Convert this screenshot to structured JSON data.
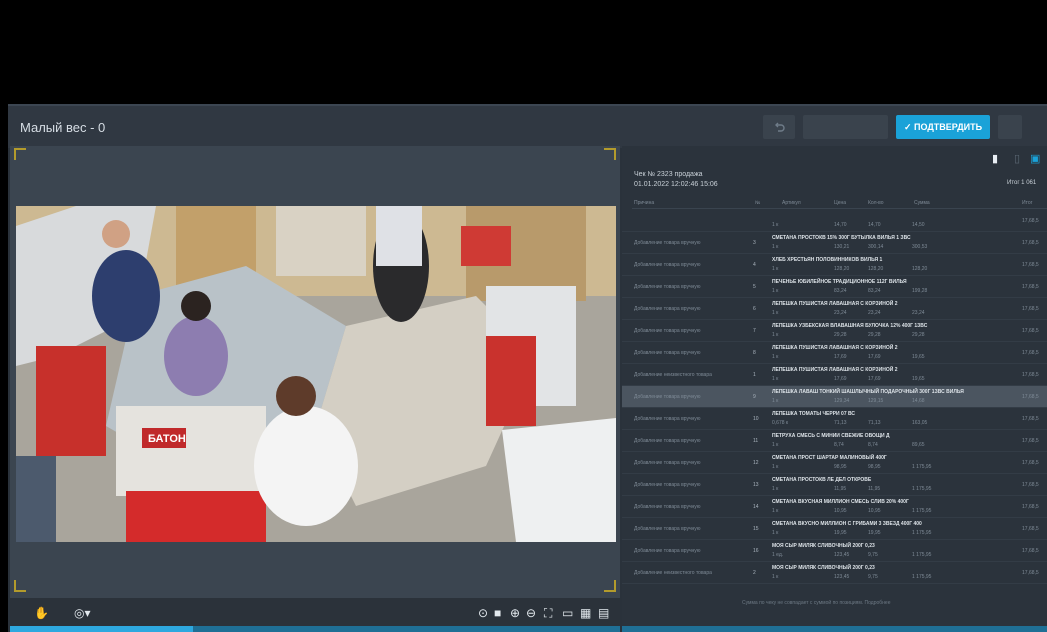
{
  "header": {
    "title": "Малый вес - 0",
    "confirm_label": "✓ ПОДТВЕРДИТЬ"
  },
  "video": {
    "bag_text": "БАТОН",
    "progress_percent": 30
  },
  "receipt": {
    "title": "Чек № 2323 продажа",
    "datetime": "01.01.2022 12:02:46 15:06",
    "total_label": "Итог 1 061",
    "columns": [
      "Причина",
      "№",
      "Артикул",
      "Цена",
      "Кол-во",
      "Сумма",
      "Итог"
    ],
    "rows": [
      {
        "cat": "",
        "num": "",
        "name": "",
        "sub": "1 к",
        "price": "14,70",
        "qty": "14,70",
        "sum": "14,50",
        "total": "17,68,5"
      },
      {
        "cat": "Добавление товара вручную",
        "num": "3",
        "name": "СМЕТАНА ПРОСТОКВ 15% 300Г БУТЫЛКА ВИЛЬЯ 1 ЗВС",
        "sub": "1 к",
        "price": "130,21",
        "qty": "300,14",
        "sum": "300,53",
        "total": "17,68,5"
      },
      {
        "cat": "Добавление товара вручную",
        "num": "4",
        "name": "ХЛЕБ ХРЕСТЬЯН ПОЛОВИННИКОВ ВИЛЬЯ 1",
        "sub": "1 к",
        "price": "128,20",
        "qty": "128,20",
        "sum": "128,20",
        "total": "17,68,5"
      },
      {
        "cat": "Добавление товара вручную",
        "num": "5",
        "name": "ПЕЧЕНЬЕ ЮБИЛЕЙНОЕ ТРАДИЦИОННОЕ 112Г ВИЛЬЯ",
        "sub": "1 к",
        "price": "83,24",
        "qty": "83,24",
        "sum": "199,28",
        "total": "17,68,5"
      },
      {
        "cat": "Добавление товара вручную",
        "num": "6",
        "name": "ЛЕПЕШКА ПУШИСТАЯ ЛАВАШНАЯ С КОРЗИНОЙ 2",
        "sub": "1 к",
        "price": "23,24",
        "qty": "23,24",
        "sum": "23,24",
        "total": "17,68,5"
      },
      {
        "cat": "Добавление товара вручную",
        "num": "7",
        "name": "ЛЕПЕШКА УЗБЕКСКАЯ ВЛАВАШНАЯ БУЛОЧКА 12% 400Г 1ЗВС",
        "sub": "1 к",
        "price": "29,28",
        "qty": "29,28",
        "sum": "29,28",
        "total": "17,68,5"
      },
      {
        "cat": "Добавление товара вручную",
        "num": "8",
        "name": "ЛЕПЕШКА ПУШИСТАЯ ЛАВАШНАЯ С КОРЗИНОЙ 2",
        "sub": "1 к",
        "price": "17,69",
        "qty": "17,69",
        "sum": "19,65",
        "total": "17,68,5"
      },
      {
        "cat": "Добавление неизвестного товара",
        "num": "1",
        "name": "ЛЕПЕШКА ПУШИСТАЯ ЛАВАШНАЯ С КОРЗИНОЙ 2",
        "sub": "1 к",
        "price": "17,69",
        "qty": "17,69",
        "sum": "19,65",
        "total": "17,68,5"
      },
      {
        "cat": "Добавление товара вручную",
        "num": "9",
        "name": "ЛЕПЕШКА ЛАВАШ ТОНКИЙ ШАШЛЫЧНЫЙ ПОДАРОЧНЫЙ 300Г 1ЗВС ВИЛЬЯ",
        "sub": "1 к",
        "price": "129,34",
        "qty": "129,15",
        "sum": "14,68",
        "total": "17,68,5",
        "selected": true
      },
      {
        "cat": "Добавление товара вручную",
        "num": "10",
        "name": "ЛЕПЕШКА ТОМАТЫ ЧЕРРИ 07 ВС",
        "sub": "0,678 к",
        "price": "71,13",
        "qty": "71,13",
        "sum": "163,05",
        "total": "17,68,5"
      },
      {
        "cat": "Добавление товара вручную",
        "num": "11",
        "name": "ПЕТРУХА СМЕСЬ С МИНИИ СВЕЖИЕ ОВОЩИ Д",
        "sub": "1 к",
        "price": "8,74",
        "qty": "8,74",
        "sum": "89,65",
        "total": "17,68,5"
      },
      {
        "cat": "Добавление товара вручную",
        "num": "12",
        "name": "СМЕТАНА ПРОСТ ШАРТАР МАЛИНОВЫЙ 400Г",
        "sub": "1 к",
        "price": "98,95",
        "qty": "98,95",
        "sum": "1 175,95",
        "total": "17,68,5"
      },
      {
        "cat": "Добавление товара вручную",
        "num": "13",
        "name": "СМЕТАНА ПРОСТОКВ ЛЕ ДЕЛ ОТКРОВЕ",
        "sub": "1 к",
        "price": "11,95",
        "qty": "11,95",
        "sum": "1 175,95",
        "total": "17,68,5"
      },
      {
        "cat": "Добавление товара вручную",
        "num": "14",
        "name": "СМЕТАНА ВКУСНАЯ МИЛЛИОН СМЕСЬ СЛИВ 20% 400Г",
        "sub": "1 к",
        "price": "10,95",
        "qty": "10,95",
        "sum": "1 175,95",
        "total": "17,68,5"
      },
      {
        "cat": "Добавление товара вручную",
        "num": "15",
        "name": "СМЕТАНА ВКУСНО МИЛЛИОН С ГРИБАМИ 3 ЗВЕЗД 400Г 400",
        "sub": "1 к",
        "price": "19,95",
        "qty": "19,95",
        "sum": "1 175,95",
        "total": "17,68,5"
      },
      {
        "cat": "Добавление товара вручную",
        "num": "16",
        "name": "МОЯ СЫР МИЛЯК СЛИВОЧНЫЙ 200Г 0,23",
        "sub": "1 ед.",
        "price": "123,45",
        "qty": "9,75",
        "sum": "1 175,95",
        "total": "17,68,5"
      },
      {
        "cat": "Добавление неизвестного товара",
        "num": "2",
        "name": "МОЯ СЫР МИЛЯК СЛИВОЧНЫЙ 200Г 0,23",
        "sub": "1 к",
        "price": "123,45",
        "qty": "9,75",
        "sum": "1 175,95",
        "total": "17,68,5"
      }
    ],
    "footer_note": "Сумма по чеку не совпадает с суммой по позициям. Подробнее"
  }
}
